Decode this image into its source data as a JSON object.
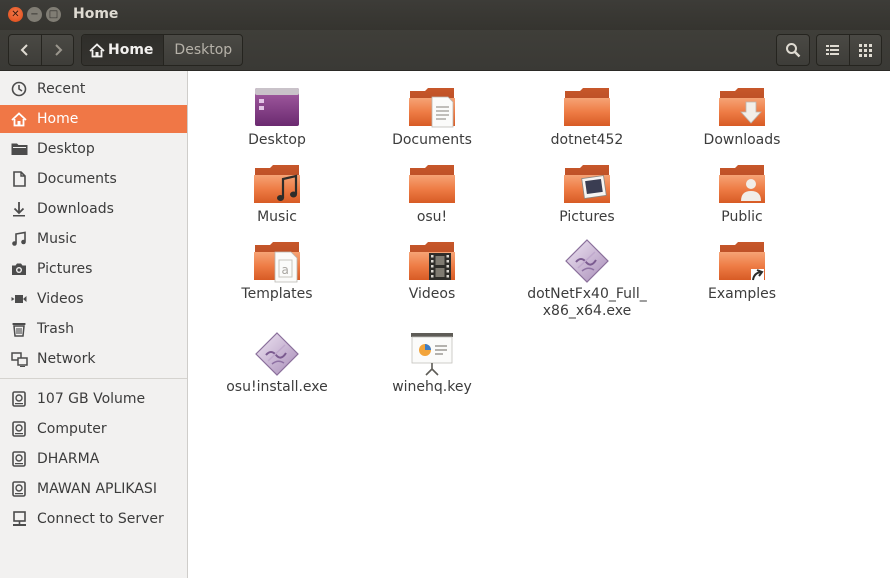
{
  "window": {
    "title": "Home"
  },
  "toolbar": {
    "breadcrumbs": [
      {
        "label": "Home"
      },
      {
        "label": "Desktop"
      }
    ]
  },
  "sidebar": {
    "places": [
      {
        "label": "Recent",
        "icon": "clock-icon"
      },
      {
        "label": "Home",
        "icon": "home-icon",
        "selected": true
      },
      {
        "label": "Desktop",
        "icon": "folder-icon"
      },
      {
        "label": "Documents",
        "icon": "document-icon"
      },
      {
        "label": "Downloads",
        "icon": "download-arrow-icon"
      },
      {
        "label": "Music",
        "icon": "music-note-icon"
      },
      {
        "label": "Pictures",
        "icon": "camera-icon"
      },
      {
        "label": "Videos",
        "icon": "video-camera-icon"
      },
      {
        "label": "Trash",
        "icon": "trash-icon"
      },
      {
        "label": "Network",
        "icon": "network-icon"
      }
    ],
    "devices": [
      {
        "label": "107 GB Volume",
        "icon": "drive-icon"
      },
      {
        "label": "Computer",
        "icon": "drive-icon"
      },
      {
        "label": "DHARMA",
        "icon": "drive-icon"
      },
      {
        "label": "MAWAN APLIKASI",
        "icon": "drive-icon"
      },
      {
        "label": "Connect to Server",
        "icon": "server-icon"
      }
    ]
  },
  "files": [
    {
      "label": "Desktop",
      "icon": "desktop-folder-icon"
    },
    {
      "label": "Documents",
      "icon": "documents-folder-icon"
    },
    {
      "label": "dotnet452",
      "icon": "folder-icon"
    },
    {
      "label": "Downloads",
      "icon": "downloads-folder-icon"
    },
    {
      "label": "Music",
      "icon": "music-folder-icon"
    },
    {
      "label": "osu!",
      "icon": "folder-icon"
    },
    {
      "label": "Pictures",
      "icon": "pictures-folder-icon"
    },
    {
      "label": "Public",
      "icon": "public-folder-icon"
    },
    {
      "label": "Templates",
      "icon": "templates-folder-icon"
    },
    {
      "label": "Videos",
      "icon": "videos-folder-icon"
    },
    {
      "label": "dotNetFx40_Full_\nx86_x64.exe",
      "icon": "wine-exe-icon"
    },
    {
      "label": "Examples",
      "icon": "examples-link-folder-icon"
    },
    {
      "label": "osu!install.exe",
      "icon": "wine-exe-icon"
    },
    {
      "label": "winehq.key",
      "icon": "presentation-file-icon"
    }
  ],
  "colors": {
    "accent": "#f07746",
    "folder": "#e8713f",
    "titlebar": "#3c3b37"
  }
}
